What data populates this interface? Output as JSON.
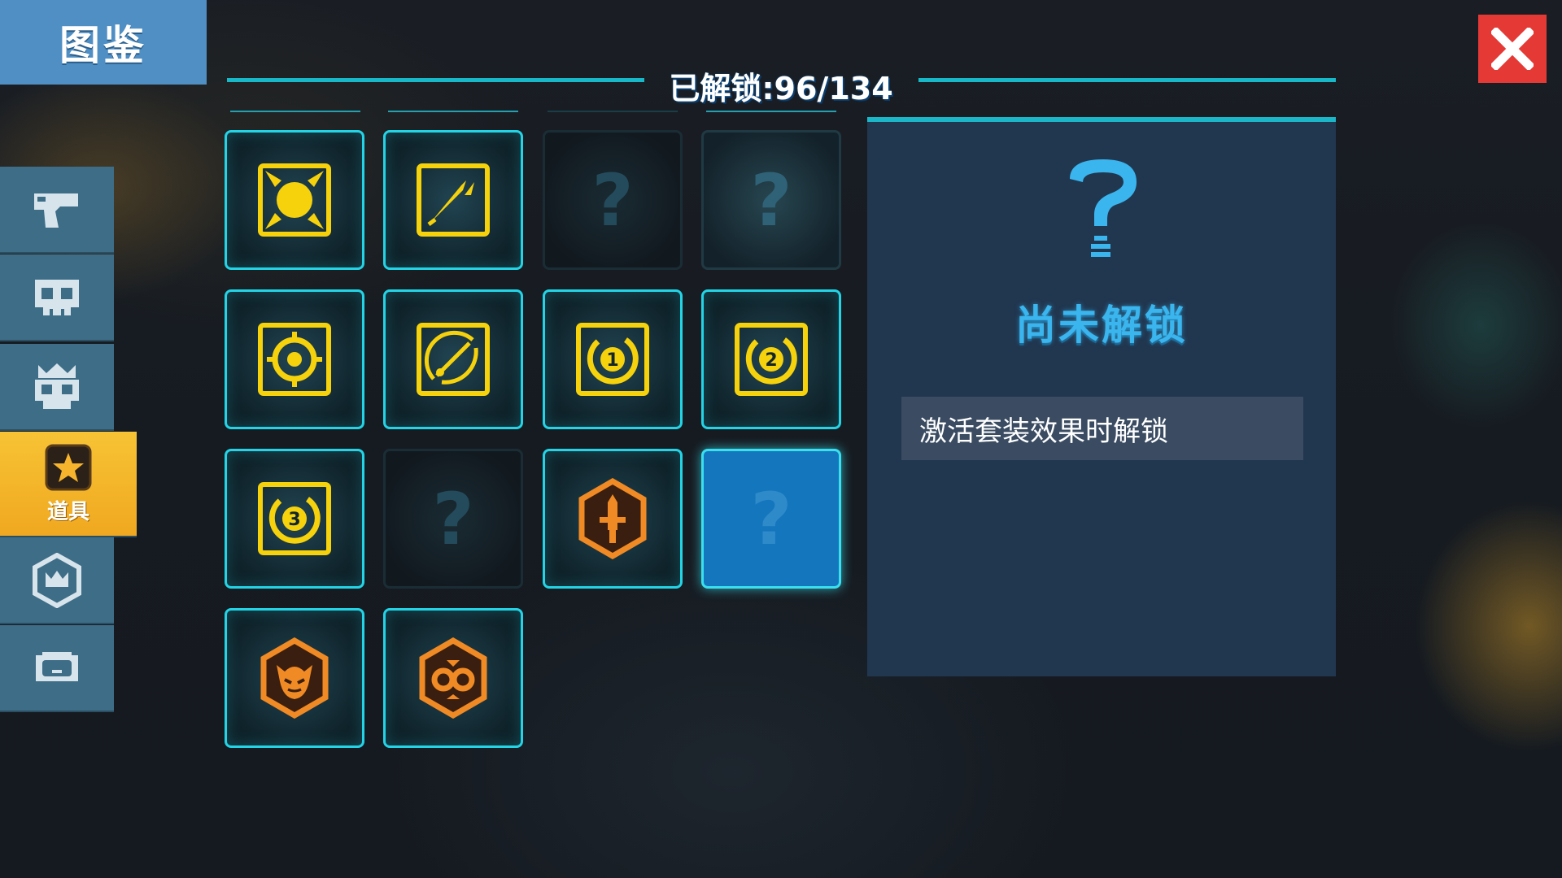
{
  "header": {
    "title": "图鉴",
    "unlock_label": "已解锁:96/134"
  },
  "sidebar": {
    "items": [
      {
        "icon": "pistol-icon",
        "label": ""
      },
      {
        "icon": "skull-icon",
        "label": ""
      },
      {
        "icon": "crowned-skull-icon",
        "label": ""
      },
      {
        "icon": "star-icon",
        "label": "道具",
        "active": true
      },
      {
        "icon": "hexagon-crown-icon",
        "label": ""
      },
      {
        "icon": "pet-face-icon",
        "label": ""
      }
    ]
  },
  "grid": {
    "items": [
      {
        "state": "unlocked",
        "icon": "sun-burst-icon"
      },
      {
        "state": "unlocked",
        "icon": "double-blade-icon"
      },
      {
        "state": "locked",
        "icon": "question-mark-icon"
      },
      {
        "state": "locked",
        "icon": "question-mark-icon"
      },
      {
        "state": "unlocked",
        "icon": "gear-eye-icon"
      },
      {
        "state": "unlocked",
        "icon": "radar-slash-icon"
      },
      {
        "state": "unlocked",
        "icon": "cooldown-1-icon",
        "badge": "1"
      },
      {
        "state": "unlocked",
        "icon": "cooldown-2-icon",
        "badge": "2"
      },
      {
        "state": "unlocked",
        "icon": "cooldown-3-icon",
        "badge": "3"
      },
      {
        "state": "locked",
        "icon": "question-mark-icon"
      },
      {
        "state": "unlocked",
        "icon": "sword-hexagon-icon"
      },
      {
        "state": "selected",
        "icon": "question-mark-icon"
      },
      {
        "state": "unlocked",
        "icon": "demon-hexagon-icon"
      },
      {
        "state": "unlocked",
        "icon": "infinity-hexagon-icon"
      }
    ],
    "locked_symbol": "?"
  },
  "detail": {
    "icon": "question-mark-icon",
    "status": "尚未解锁",
    "description": "激活套装效果时解锁"
  },
  "colors": {
    "accent_cyan": "#22d4e6",
    "item_yellow": "#f5d20c",
    "item_orange": "#f08a24",
    "close_red": "#e53935",
    "active_tab": "#f2b12a",
    "sidebar_blue": "#3e6d87"
  }
}
